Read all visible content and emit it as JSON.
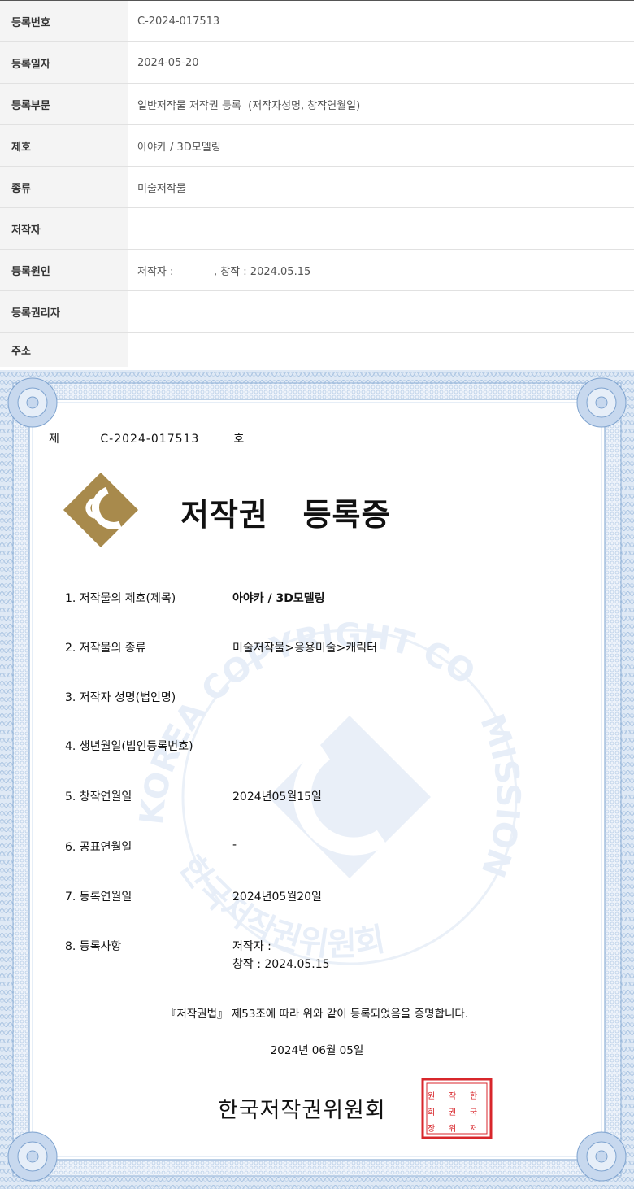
{
  "info_table": {
    "rows": [
      {
        "label": "등록번호",
        "value": "C-2024-017513"
      },
      {
        "label": "등록일자",
        "value": "2024-05-20"
      },
      {
        "label": "등록부문",
        "value": "일반저작물 저작권 등록  (저작자성명, 창작연월일)"
      },
      {
        "label": "제호",
        "value": "아야카 / 3D모델링"
      },
      {
        "label": "종류",
        "value": "미술저작물"
      },
      {
        "label": "저작자",
        "value": ""
      },
      {
        "label": "등록원인",
        "value": "저작자 :            , 창작 : 2024.05.15"
      },
      {
        "label": "등록권리자",
        "value": ""
      },
      {
        "label": "주소",
        "value": ""
      }
    ]
  },
  "certificate": {
    "reg_prefix": "제",
    "reg_number": "C-2024-017513",
    "reg_suffix": "호",
    "title": "저작권   등록증",
    "watermark_top": "KOREA COPYRIGHT COM",
    "watermark_right": "MISSION",
    "watermark_bottom": "한국저작권위원회",
    "fields": [
      {
        "label": "1. 저작물의 제호(제목)",
        "value": "아야카 / 3D모델링"
      },
      {
        "label": "2. 저작물의 종류",
        "value": "미술저작물>응용미술>캐릭터"
      },
      {
        "label": "3. 저작자 성명(법인명)",
        "value": ""
      },
      {
        "label": "4. 생년월일(법인등록번호)",
        "value": ""
      },
      {
        "label": "5. 창작연월일",
        "value": "2024년05월15일"
      },
      {
        "label": "6. 공표연월일",
        "value": "-"
      },
      {
        "label": "7. 등록연월일",
        "value": "2024년05월20일"
      },
      {
        "label": "8. 등록사항",
        "value": "저작자 :",
        "value2": "창작 : 2024.05.15"
      }
    ],
    "statement": "『저작권법』 제53조에 따라 위와 같이 등록되었음을 증명합니다.",
    "issue_date": "2024년 06월 05일",
    "organization": "한국저작권위원회",
    "seal_chars": [
      "한",
      "국",
      "저",
      "작",
      "권",
      "위",
      "원",
      "회",
      "장"
    ],
    "colors": {
      "border_blue": "#9ab9dc",
      "logo_gold": "#a88a4c",
      "seal_red": "#d8262b",
      "watermark": "#e7eef8"
    }
  }
}
